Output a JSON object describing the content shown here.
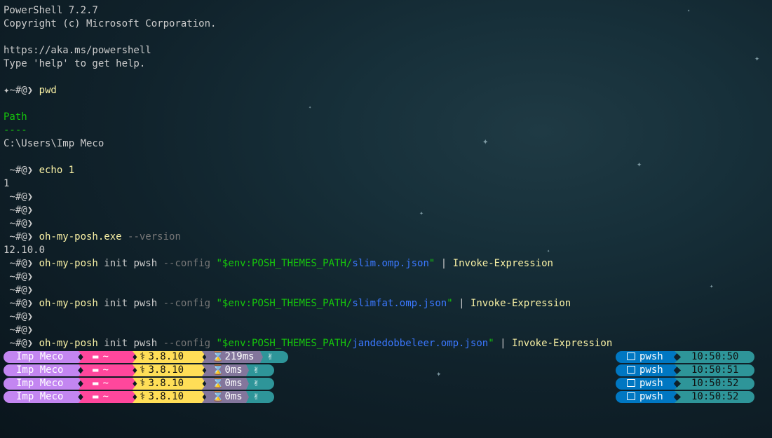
{
  "terminal": {
    "lines": [
      [
        {
          "t": "PowerShell 7.2.7",
          "c": ""
        }
      ],
      [
        {
          "t": "Copyright (c) Microsoft Corporation.",
          "c": ""
        }
      ],
      [
        {
          "t": "",
          "c": ""
        }
      ],
      [
        {
          "t": "https://aka.ms/powershell",
          "c": ""
        }
      ],
      [
        {
          "t": "Type 'help' to get help.",
          "c": ""
        }
      ],
      [
        {
          "t": "",
          "c": ""
        }
      ],
      [
        {
          "t": "✦~#@❯ ",
          "c": "prompt"
        },
        {
          "t": "pwd",
          "c": "cmd"
        }
      ],
      [
        {
          "t": "",
          "c": ""
        }
      ],
      [
        {
          "t": "Path",
          "c": "grn"
        }
      ],
      [
        {
          "t": "----",
          "c": "grn"
        }
      ],
      [
        {
          "t": "C:\\Users\\Imp Meco",
          "c": ""
        }
      ],
      [
        {
          "t": "",
          "c": ""
        }
      ],
      [
        {
          "t": " ~#@❯ ",
          "c": "prompt"
        },
        {
          "t": "echo 1",
          "c": "cmd"
        }
      ],
      [
        {
          "t": "1",
          "c": ""
        }
      ],
      [
        {
          "t": " ~#@❯",
          "c": "prompt"
        }
      ],
      [
        {
          "t": " ~#@❯",
          "c": "prompt"
        }
      ],
      [
        {
          "t": " ~#@❯",
          "c": "prompt"
        }
      ],
      [
        {
          "t": " ~#@❯ ",
          "c": "prompt"
        },
        {
          "t": "oh-my-posh.exe",
          "c": "cmd"
        },
        {
          "t": " --version",
          "c": "opt"
        }
      ],
      [
        {
          "t": "12.10.0",
          "c": ""
        }
      ],
      [
        {
          "t": " ~#@❯ ",
          "c": "prompt"
        },
        {
          "t": "oh-my-posh",
          "c": "cmd"
        },
        {
          "t": " init pwsh",
          "c": ""
        },
        {
          "t": " --config ",
          "c": "opt"
        },
        {
          "t": "\"$env:POSH_THEMES_PATH/",
          "c": "str"
        },
        {
          "t": "slim.omp.json",
          "c": "path"
        },
        {
          "t": "\"",
          "c": "str"
        },
        {
          "t": " | ",
          "c": ""
        },
        {
          "t": "Invoke-Expression",
          "c": "cmd"
        }
      ],
      [
        {
          "t": " ~#@❯",
          "c": "prompt"
        }
      ],
      [
        {
          "t": " ~#@❯",
          "c": "prompt"
        }
      ],
      [
        {
          "t": " ~#@❯ ",
          "c": "prompt"
        },
        {
          "t": "oh-my-posh",
          "c": "cmd"
        },
        {
          "t": " init pwsh",
          "c": ""
        },
        {
          "t": " --config ",
          "c": "opt"
        },
        {
          "t": "\"$env:POSH_THEMES_PATH/",
          "c": "str"
        },
        {
          "t": "slimfat.omp.json",
          "c": "path"
        },
        {
          "t": "\"",
          "c": "str"
        },
        {
          "t": " | ",
          "c": ""
        },
        {
          "t": "Invoke-Expression",
          "c": "cmd"
        }
      ],
      [
        {
          "t": " ~#@❯",
          "c": "prompt"
        }
      ],
      [
        {
          "t": " ~#@❯",
          "c": "prompt"
        }
      ],
      [
        {
          "t": " ~#@❯ ",
          "c": "prompt"
        },
        {
          "t": "oh-my-posh",
          "c": "cmd"
        },
        {
          "t": " init pwsh",
          "c": ""
        },
        {
          "t": " --config ",
          "c": "opt"
        },
        {
          "t": "\"$env:POSH_THEMES_PATH/",
          "c": "str"
        },
        {
          "t": "jandedobbeleer.omp.json",
          "c": "path"
        },
        {
          "t": "\"",
          "c": "str"
        },
        {
          "t": " | ",
          "c": ""
        },
        {
          "t": "Invoke-Expression",
          "c": "cmd"
        }
      ]
    ]
  },
  "prompt_rows": [
    {
      "user": "Imp Meco",
      "path": "~",
      "python": "3.8.10",
      "exec": "219ms",
      "status": "✌",
      "shell": "pwsh",
      "time": "10:50:50"
    },
    {
      "user": "Imp Meco",
      "path": "~",
      "python": "3.8.10",
      "exec": "0ms",
      "status": "✌",
      "shell": "pwsh",
      "time": "10:50:51"
    },
    {
      "user": "Imp Meco",
      "path": "~",
      "python": "3.8.10",
      "exec": "0ms",
      "status": "✌",
      "shell": "pwsh",
      "time": "10:50:52"
    },
    {
      "user": "Imp Meco",
      "path": "~",
      "python": "3.8.10",
      "exec": "0ms",
      "status": "✌",
      "shell": "pwsh",
      "time": "10:50:52"
    }
  ],
  "icons": {
    "folder": "folder-icon",
    "python": "python-icon",
    "hourglass": "hourglass-icon",
    "status": "hand-icon",
    "terminal": "terminal-icon"
  },
  "colors": {
    "user": "#c386f1",
    "path": "#ff479c",
    "python": "#ffde57",
    "exec": "#83769c",
    "status": "#2e9599",
    "shell": "#0077c2",
    "time": "#2e9599"
  }
}
